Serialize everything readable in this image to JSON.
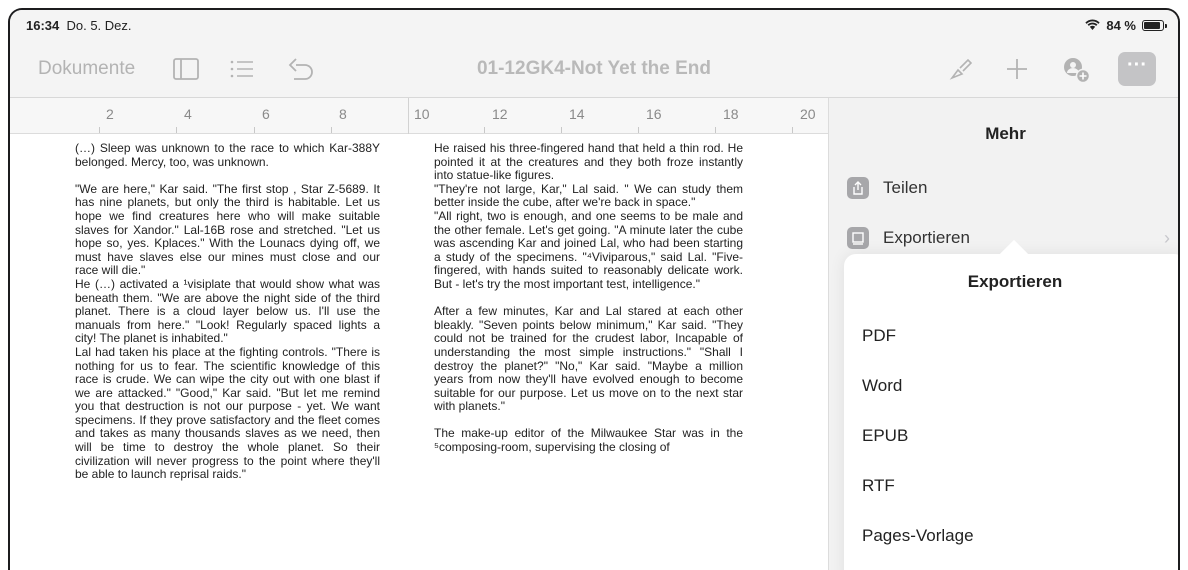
{
  "status": {
    "time": "16:34",
    "date": "Do. 5. Dez.",
    "battery": "84 %"
  },
  "toolbar": {
    "documents": "Dokumente",
    "title": "01-12GK4-Not Yet the End",
    "more": "···"
  },
  "ruler": {
    "numbers": [
      "2",
      "4",
      "6",
      "8",
      "10",
      "12",
      "14",
      "16",
      "18",
      "20"
    ]
  },
  "document": {
    "left_column": [
      "(…) Sleep was unknown to the race to which Kar-388Y belonged. Mercy, too, was unknown.",
      "",
      "\"We are here,\" Kar said. \"The first stop , Star Z-5689. It has nine planets, but only the third is habitable. Let us hope we find creatures here who will make suitable slaves for Xandor.\" Lal-16B rose and stretched. \"Let us hope so, yes. Kplaces.\" With the Lounacs dying off, we must have slaves else our mines must close and our race will die.\"",
      "He (…) activated a ¹visiplate that would show what was beneath them. \"We are above the night side of the third planet. There is a cloud layer below us. I'll use the manuals from here.\" \"Look! Regularly spaced lights a city! The planet is inhabited.\"",
      "Lal had taken his place at the fighting controls. \"There is nothing for us to fear. The scientific knowledge of this race is crude. We can wipe the city out with one blast if we are attacked.\" \"Good,\" Kar said. \"But let me remind you that destruction is not our purpose - yet. We want specimens. If they prove satisfactory and the fleet comes and takes as many thousands slaves as we need, then will be time to destroy the whole planet. So their civilization will never progress to the point where they'll be able to launch reprisal raids.\""
    ],
    "right_column": [
      "He raised his three-fingered hand that held a thin rod. He  pointed it at the creatures and they both froze instantly into statue-like figures.",
      "\"They're not large, Kar,\" Lal said. \" We can study them better inside the cube, after we're back in space.\"",
      "\"All right, two is enough, and one seems to be male and the other female. Let's get going. \"A minute later the cube was ascending Kar and joined  Lal, who had been starting a study of the specimens. \"⁴Viviparous,\" said Lal. \"Five-fingered, with hands suited to reasonably delicate work. But - let's  try the most important test, intelligence.\"",
      "",
      " After a few minutes, Kar and Lal stared at each other bleakly. \"Seven points below minimum,\" Kar said. \"They could not be trained for the crudest labor, Incapable of understanding the most simple instructions.\" \"Shall I destroy the planet?\" \"No,\" Kar said. \"Maybe a million years from now they'll have evolved enough to become suitable for our purpose. Let us move on to the next star with planets.\"",
      "",
      "The make-up editor of the Milwaukee Star  was in the ⁵composing-room, supervising the closing of"
    ]
  },
  "panel": {
    "title": "Mehr",
    "items": [
      {
        "label": "Teilen",
        "icon": "share-icon"
      },
      {
        "label": "Exportieren",
        "icon": "export-icon"
      }
    ]
  },
  "export_popover": {
    "title": "Exportieren",
    "options": [
      "PDF",
      "Word",
      "EPUB",
      "RTF",
      "Pages-Vorlage"
    ]
  }
}
